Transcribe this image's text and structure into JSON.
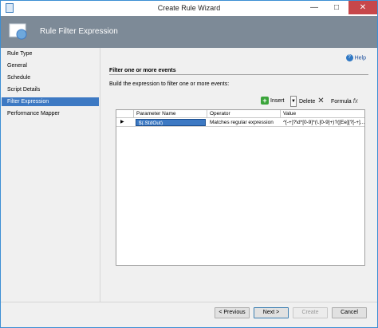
{
  "window": {
    "title": "Create Rule Wizard"
  },
  "header": {
    "title": "Rule Filter Expression"
  },
  "nav": {
    "items": [
      {
        "label": "Rule Type",
        "active": false
      },
      {
        "label": "General",
        "active": false
      },
      {
        "label": "Schedule",
        "active": false
      },
      {
        "label": "Script Details",
        "active": false
      },
      {
        "label": "Filter Expression",
        "active": true
      },
      {
        "label": "Performance Mapper",
        "active": false
      }
    ]
  },
  "content": {
    "help_label": "Help",
    "section_title": "Filter one or more events",
    "instruction": "Build the expression to filter one or more events:",
    "toolbar": {
      "insert": "Insert",
      "delete": "Delete",
      "formula": "Formula"
    },
    "grid": {
      "columns": [
        "Parameter Name",
        "Operator",
        "Value"
      ],
      "rows": [
        {
          "param": "$(.StdOut)",
          "operator": "Matches regular expression",
          "value": "^[-+]?\\d*[0-9]*(\\.[0-9]+)?([Ee][?[-+]..."
        }
      ]
    }
  },
  "footer": {
    "previous": "< Previous",
    "next": "Next >",
    "create": "Create",
    "cancel": "Cancel"
  },
  "colors": {
    "accent": "#3d79c3",
    "header_bg": "#7d8a97",
    "close_btn": "#c7474a"
  },
  "icons": {
    "help": "help-circle-icon",
    "insert": "plus-icon",
    "delete": "x-icon",
    "formula": "formula-icon"
  }
}
